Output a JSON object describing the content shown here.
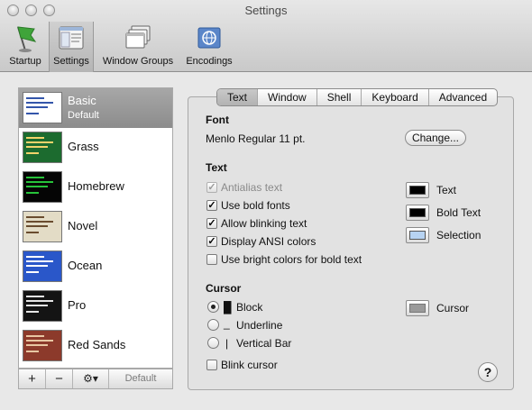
{
  "window": {
    "title": "Settings"
  },
  "toolbar": {
    "items": [
      {
        "label": "Startup",
        "icon": "startup-flag-icon"
      },
      {
        "label": "Settings",
        "icon": "settings-icon",
        "selected": true
      },
      {
        "label": "Window Groups",
        "icon": "window-groups-icon"
      },
      {
        "label": "Encodings",
        "icon": "encodings-icon"
      }
    ]
  },
  "profiles": {
    "items": [
      {
        "name": "Basic",
        "sub": "Default",
        "selected": true,
        "bg": "#ffffff",
        "fg": "#3355aa"
      },
      {
        "name": "Grass",
        "bg": "#1c6b2f",
        "fg": "#f2d36b"
      },
      {
        "name": "Homebrew",
        "bg": "#050505",
        "fg": "#27c33a"
      },
      {
        "name": "Novel",
        "bg": "#e3dcc6",
        "fg": "#6a4c2e"
      },
      {
        "name": "Ocean",
        "bg": "#2a57c9",
        "fg": "#ffffff"
      },
      {
        "name": "Pro",
        "bg": "#141414",
        "fg": "#e6e6e6"
      },
      {
        "name": "Red Sands",
        "bg": "#8c3a2b",
        "fg": "#e8c7a3"
      }
    ],
    "add_label": "+",
    "remove_label": "−",
    "gear_label": "⚙▾",
    "default_label": "Default"
  },
  "tabs": [
    "Text",
    "Window",
    "Shell",
    "Keyboard",
    "Advanced"
  ],
  "font_section": {
    "title": "Font",
    "value": "Menlo Regular 11 pt.",
    "change_label": "Change..."
  },
  "text_section": {
    "title": "Text",
    "options": [
      {
        "label": "Antialias text",
        "checked": true,
        "disabled": true
      },
      {
        "label": "Use bold fonts",
        "checked": true
      },
      {
        "label": "Allow blinking text",
        "checked": true
      },
      {
        "label": "Display ANSI colors",
        "checked": true
      },
      {
        "label": "Use bright colors for bold text",
        "checked": false
      }
    ],
    "colors": [
      {
        "label": "Text",
        "color": "#000000"
      },
      {
        "label": "Bold Text",
        "color": "#000000"
      },
      {
        "label": "Selection",
        "color": "#b7d3f2"
      }
    ]
  },
  "cursor_section": {
    "title": "Cursor",
    "options": [
      {
        "glyph": "█",
        "label": "Block",
        "selected": true
      },
      {
        "glyph": "_",
        "label": "Underline",
        "selected": false
      },
      {
        "glyph": "|",
        "label": "Vertical Bar",
        "selected": false
      }
    ],
    "blink_label": "Blink cursor",
    "color_label": "Cursor",
    "color": "#9a9a9a"
  },
  "help_label": "?"
}
